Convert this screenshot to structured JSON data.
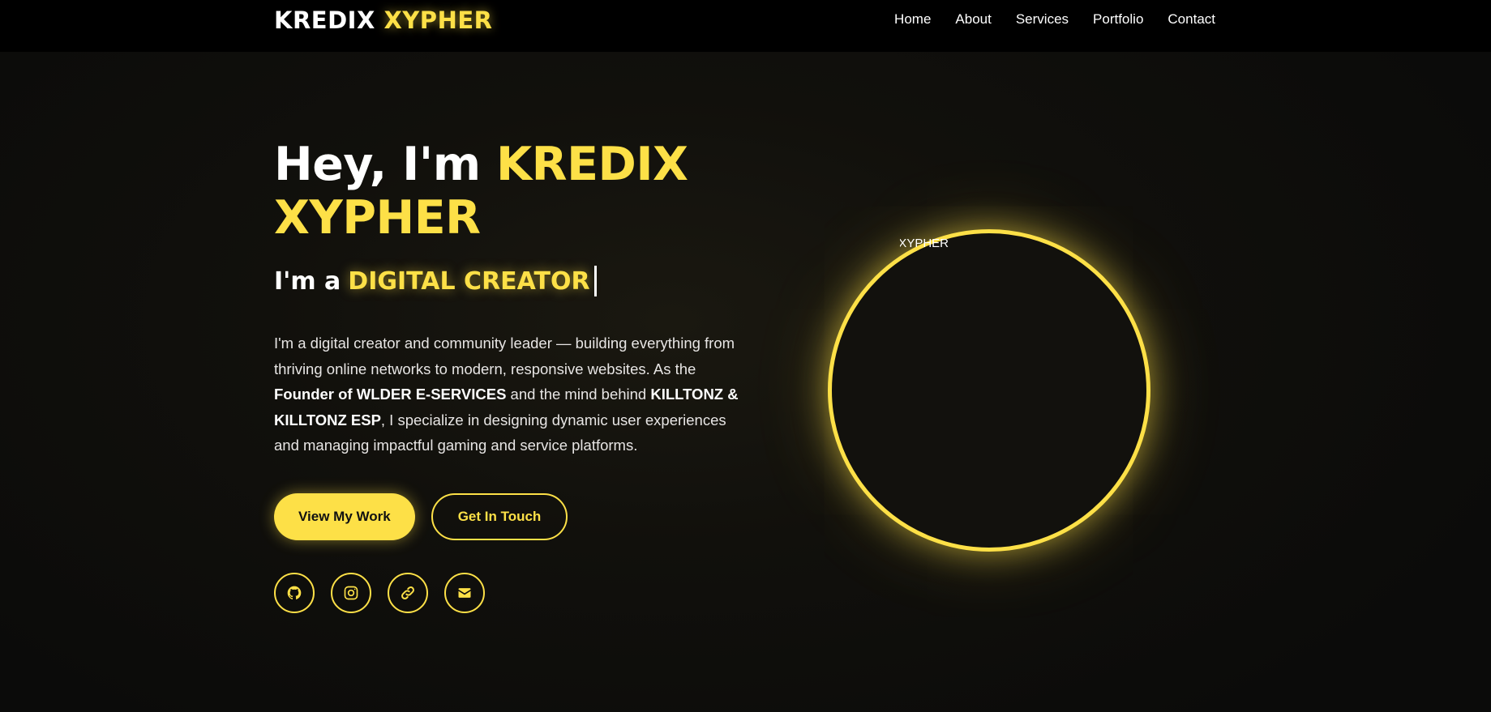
{
  "brand": {
    "name_part1": "KREDIX",
    "name_part2": "XYPHER"
  },
  "nav": {
    "links": [
      "Home",
      "About",
      "Services",
      "Portfolio",
      "Contact"
    ]
  },
  "hero": {
    "greeting": "Hey, I'm",
    "name_line1": "KREDIX",
    "name_line2": "XYPHER",
    "subtitle_prefix": "I'm a",
    "subtitle_role": "DIGITAL CREATOR",
    "bio": {
      "part1": "I'm a digital creator and community leader — building everything from thriving online networks to modern, responsive websites. As the ",
      "bold1": "Founder of WLDER E-SERVICES",
      "part2": " and the mind behind ",
      "bold2": "KILLTONZ & KILLTONZ ESP",
      "part3": ", I specialize in designing dynamic user experiences and managing impactful gaming and service platforms."
    },
    "primary_button": "View My Work",
    "secondary_button": "Get In Touch",
    "socials": [
      "github-icon",
      "instagram-icon",
      "link-icon",
      "envelope-icon"
    ],
    "avatar_alt": "KREDIX XYPHER"
  },
  "colors": {
    "accent": "#fde047",
    "background": "#0b0b0a",
    "navbar": "#000000",
    "text": "#ffffff"
  }
}
